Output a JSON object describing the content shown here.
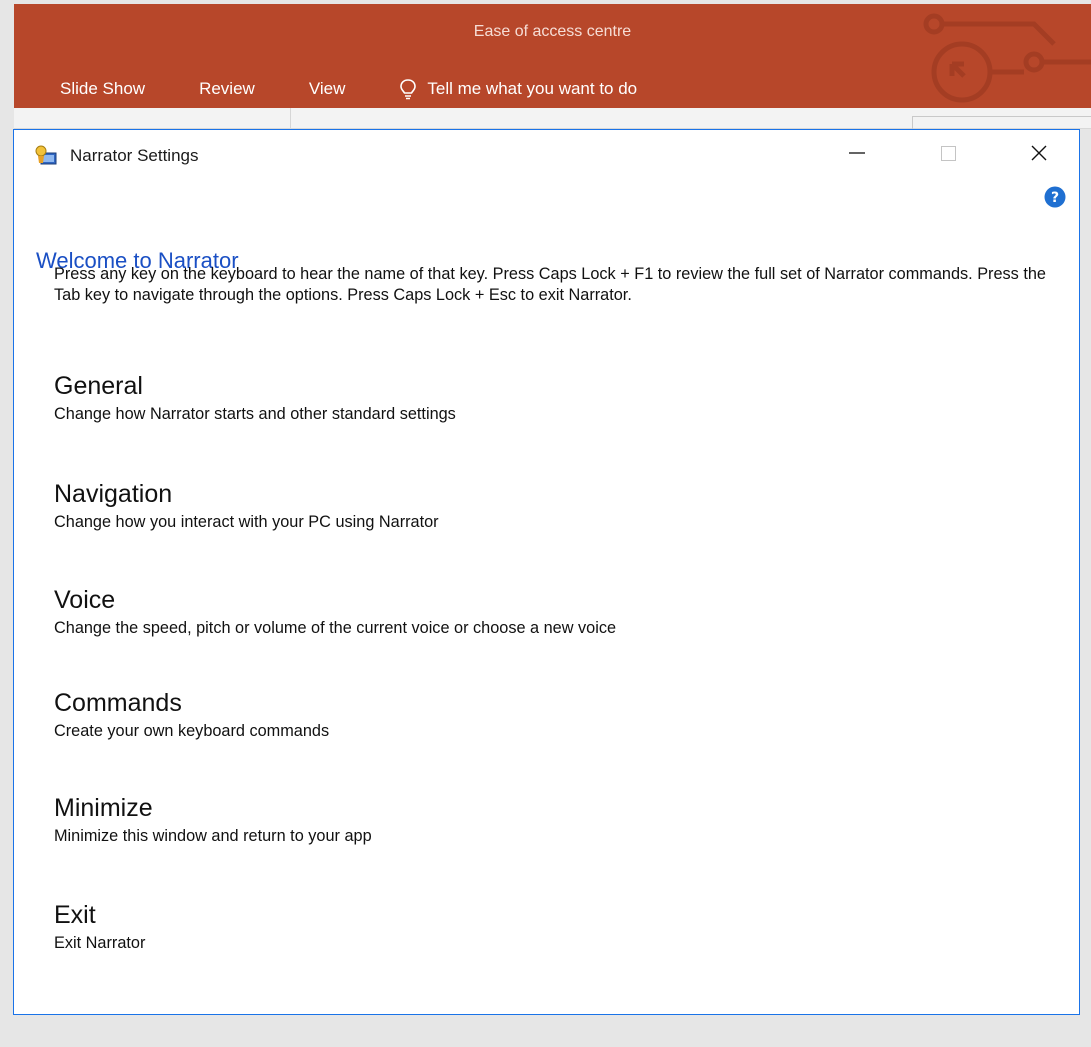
{
  "ribbon": {
    "title": "Ease of access centre",
    "tabs": [
      "Slide Show",
      "Review",
      "View"
    ],
    "tell_me": "Tell me what you want to do",
    "accent": "#b7472a"
  },
  "window": {
    "title": "Narrator Settings",
    "border_color": "#1a73e8"
  },
  "content": {
    "heading": "Welcome to Narrator",
    "heading_color": "#1a4fc4",
    "intro": "Press any key on the keyboard to hear the name of that key.  Press Caps Lock + F1 to review the full set of Narrator commands.  Press the Tab key to navigate through the options.  Press Caps Lock + Esc to exit Narrator.",
    "sections": [
      {
        "title": "General",
        "desc": "Change how Narrator starts and other standard settings"
      },
      {
        "title": "Navigation",
        "desc": "Change how you interact with your PC using Narrator"
      },
      {
        "title": "Voice",
        "desc": "Change the speed, pitch or volume of the current voice or choose a new voice"
      },
      {
        "title": "Commands",
        "desc": "Create your own keyboard commands"
      },
      {
        "title": "Minimize",
        "desc": "Minimize this window and return to your app"
      },
      {
        "title": "Exit",
        "desc": "Exit Narrator"
      }
    ]
  }
}
